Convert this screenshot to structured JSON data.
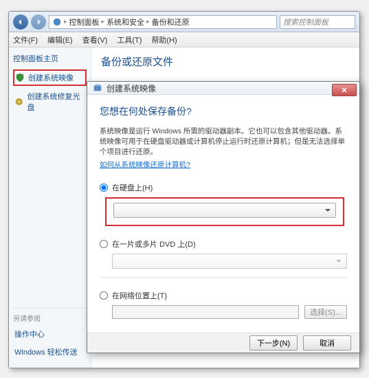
{
  "addressbar": {
    "crumbs": [
      "控制面板",
      "系统和安全",
      "备份和还原"
    ],
    "search_placeholder": "搜索控制面板"
  },
  "menubar": {
    "items": [
      "文件(F)",
      "编辑(E)",
      "查看(V)",
      "工具(T)",
      "帮助(H)"
    ]
  },
  "sidebar": {
    "title": "控制面板主页",
    "links": [
      {
        "label": "创建系统映像",
        "icon": "shield"
      },
      {
        "label": "创建系统修复光盘",
        "icon": "disc"
      }
    ],
    "footer_title": "另请参阅",
    "footer_links": [
      "操作中心",
      "Windows 轻松传送"
    ]
  },
  "main": {
    "page_title": "备份或还原文件"
  },
  "dialog": {
    "title": "创建系统映像",
    "question": "您想在何处保存备份?",
    "description": "系统映像是运行 Windows 所需的驱动器副本。它也可以包含其他驱动器。系统映像可用于在硬盘驱动器或计算机停止运行时还原计算机；但是无法选择单个项目进行还原。",
    "help_link": "如何从系统映像还原计算机?",
    "options": {
      "hard_disk": "在硬盘上(H)",
      "dvd": "在一片或多片 DVD 上(D)",
      "network": "在网络位置上(T)"
    },
    "browse_label": "选择(S)...",
    "next_label": "下一步(N)",
    "cancel_label": "取消"
  }
}
